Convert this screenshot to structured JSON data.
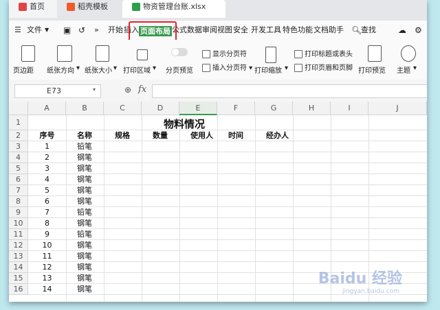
{
  "tabs": [
    {
      "label": "首页"
    },
    {
      "label": "稻壳模板"
    },
    {
      "label": "物资管理台账.xlsx"
    }
  ],
  "menu": {
    "file": "文件",
    "items": [
      "开始",
      "插入",
      "页面布局",
      "公式",
      "数据",
      "审阅",
      "视图",
      "安全",
      "开发工具",
      "特色功能",
      "文档助手"
    ],
    "active": "页面布局",
    "search": "查找"
  },
  "ribbon": {
    "margins": "页边距",
    "orientation": "纸张方向",
    "size": "纸张大小",
    "print_area": "打印区域",
    "page_preview": "分页预览",
    "show_breaks": "显示分页符",
    "insert_break": "插入分页符",
    "print_scale": "打印缩放",
    "print_titles": "打印标题或表头",
    "header_footer": "打印页眉和页脚",
    "print_preview": "打印预览",
    "theme": "主题"
  },
  "formula_bar": {
    "name_box": "E73",
    "fx": "fx",
    "value": ""
  },
  "sheet": {
    "columns": [
      "A",
      "B",
      "C",
      "D",
      "E",
      "F",
      "G",
      "H",
      "I",
      "J"
    ],
    "selected_column": "E",
    "title": "物料情况",
    "headers": [
      "序号",
      "名称",
      "规格",
      "数量",
      "使用人",
      "时间",
      "经办人"
    ],
    "rows": [
      {
        "row": "3",
        "no": "1",
        "name": "铅笔"
      },
      {
        "row": "4",
        "no": "2",
        "name": "钢笔"
      },
      {
        "row": "5",
        "no": "3",
        "name": "钢笔"
      },
      {
        "row": "6",
        "no": "4",
        "name": "钢笔"
      },
      {
        "row": "7",
        "no": "5",
        "name": "钢笔"
      },
      {
        "row": "8",
        "no": "6",
        "name": "钢笔"
      },
      {
        "row": "9",
        "no": "7",
        "name": "铅笔"
      },
      {
        "row": "10",
        "no": "8",
        "name": "钢笔"
      },
      {
        "row": "11",
        "no": "9",
        "name": "铅笔"
      },
      {
        "row": "12",
        "no": "10",
        "name": "钢笔"
      },
      {
        "row": "13",
        "no": "11",
        "name": "钢笔"
      },
      {
        "row": "14",
        "no": "12",
        "name": "钢笔"
      },
      {
        "row": "15",
        "no": "13",
        "name": "钢笔"
      },
      {
        "row": "16",
        "no": "14",
        "name": "钢笔"
      }
    ]
  },
  "watermark": {
    "text": "Baidu 经验",
    "sub": "jingyan.baidu.com"
  }
}
